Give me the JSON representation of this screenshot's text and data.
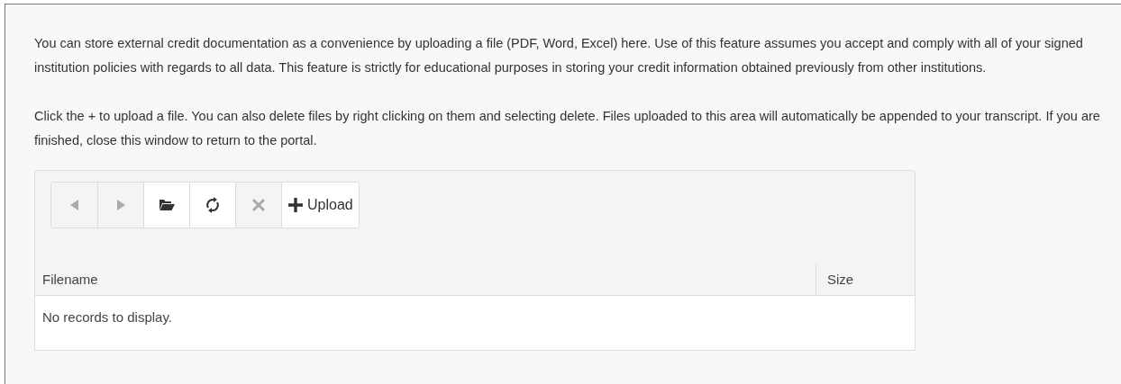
{
  "paragraphs": [
    "You can store external credit documentation as a convenience by uploading a file (PDF, Word, Excel) here. Use of this feature assumes you accept and comply with all of your signed institution policies with regards to all data. This feature is strictly for educational purposes in storing your credit information obtained previously from other institutions.",
    "Click the + to upload a file. You can also delete files by right clicking on them and selecting delete. Files uploaded to this area will automatically be appended to your transcript. If you are finished, close this window to return to the portal."
  ],
  "toolbar": [
    {
      "kind": "back",
      "disabled": true
    },
    {
      "kind": "forward",
      "disabled": true
    },
    {
      "kind": "folder",
      "disabled": false
    },
    {
      "kind": "refresh",
      "disabled": false
    },
    {
      "kind": "delete",
      "disabled": true
    },
    {
      "kind": "upload",
      "label": "Upload",
      "disabled": false
    }
  ],
  "table": {
    "columns": [
      "Filename",
      "Size"
    ],
    "empty_message": "No records to display."
  }
}
